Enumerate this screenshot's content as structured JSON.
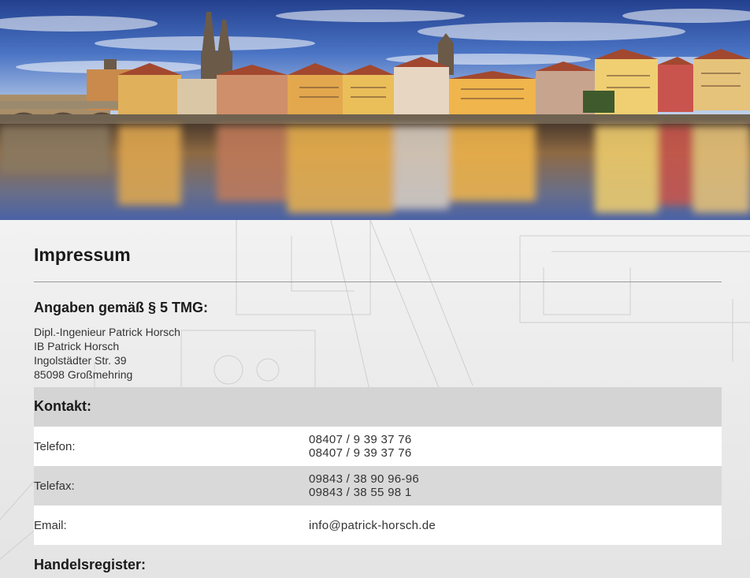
{
  "page": {
    "title": "Impressum"
  },
  "tmg": {
    "heading": "Angaben gemäß § 5 TMG:",
    "address_lines": [
      "Dipl.-Ingenieur Patrick Horsch",
      "IB Patrick Horsch",
      "Ingolstädter Str. 39",
      "85098 Großmehring"
    ]
  },
  "contact": {
    "heading": "Kontakt:",
    "rows": [
      {
        "label": "Telefon:",
        "values": [
          "08407 / 9 39 37 76",
          "08407 / 9 39 37 76"
        ]
      },
      {
        "label": "Telefax:",
        "values": [
          "09843 / 38 90 96-96",
          "09843 / 38 55 98 1"
        ]
      },
      {
        "label": "Email:",
        "values": [
          "info@patrick-horsch.de"
        ]
      }
    ]
  },
  "register": {
    "heading": "Handelsregister:"
  },
  "colors": {
    "sky_top": "#2f4fa8",
    "sky_bottom": "#b9cdea",
    "water": "#8a6a4a",
    "row_grey": "#d9d9d9",
    "row_white": "#ffffff"
  }
}
